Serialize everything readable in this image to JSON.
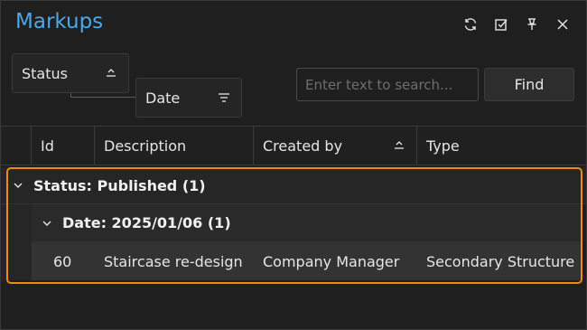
{
  "window": {
    "title": "Markups"
  },
  "title_actions": [
    {
      "name": "refresh-icon"
    },
    {
      "name": "checkbox-icon"
    },
    {
      "name": "pin-icon"
    },
    {
      "name": "close-icon"
    }
  ],
  "grouping": {
    "status_label": "Status",
    "date_label": "Date"
  },
  "search": {
    "placeholder": "Enter text to search...",
    "find_label": "Find"
  },
  "columns": {
    "id": "Id",
    "description": "Description",
    "created_by": "Created by",
    "type": "Type"
  },
  "groups": {
    "status_group": "Status: Published (1)",
    "date_group": "Date: 2025/01/06 (1)"
  },
  "rows": [
    {
      "id": "60",
      "description": "Staircase re-design",
      "created_by": "Company Manager",
      "type": "Secondary Structure"
    }
  ],
  "colors": {
    "accent": "#4aa8e8",
    "highlight": "#f08a10"
  }
}
